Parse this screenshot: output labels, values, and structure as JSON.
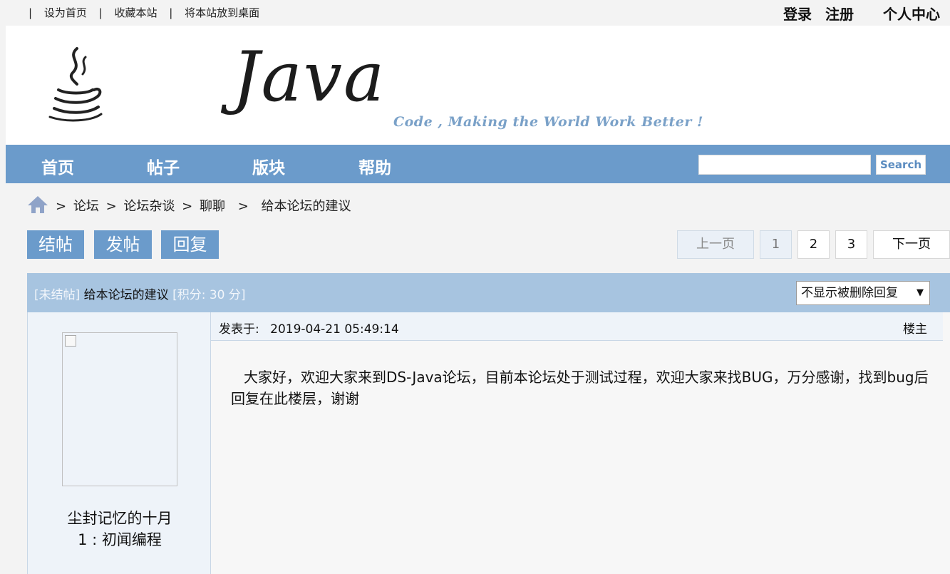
{
  "topbar": {
    "links": [
      "设为首页",
      "收藏本站",
      "将本站放到桌面"
    ],
    "separator": "|",
    "login": "登录",
    "register": "注册",
    "profile": "个人中心"
  },
  "banner": {
    "wordmark": "Java",
    "slogan": "Code , Making the World Work Better !"
  },
  "nav": {
    "items": [
      "首页",
      "帖子",
      "版块",
      "帮助"
    ],
    "search_button": "Search",
    "search_value": ""
  },
  "breadcrumb": {
    "items": [
      "论坛",
      "论坛杂谈",
      "聊聊",
      "给本论坛的建议"
    ],
    "separator": ">"
  },
  "actions": {
    "close": "结帖",
    "post": "发帖",
    "reply": "回复"
  },
  "pager": {
    "prev": "上一页",
    "pages": [
      "1",
      "2",
      "3"
    ],
    "current": "1",
    "next": "下一页"
  },
  "thread": {
    "status": "[未结帖]",
    "title": "给本论坛的建议",
    "points": "[积分: 30 分]",
    "filter_selected": "不显示被删除回复"
  },
  "post": {
    "author": "尘封记忆的十月",
    "rank": "1 : 初闻编程",
    "date_label": "发表于:",
    "date": "2019-04-21 05:49:14",
    "floor": "楼主",
    "body": "大家好，欢迎大家来到DS-Java论坛，目前本论坛处于测试过程，欢迎大家来找BUG，万分感谢，找到bug后回复在此楼层，谢谢"
  },
  "colors": {
    "nav_bg": "#6b9bcb",
    "thread_header_bg": "#a7c4e0",
    "slogan": "#7aa1c8"
  }
}
